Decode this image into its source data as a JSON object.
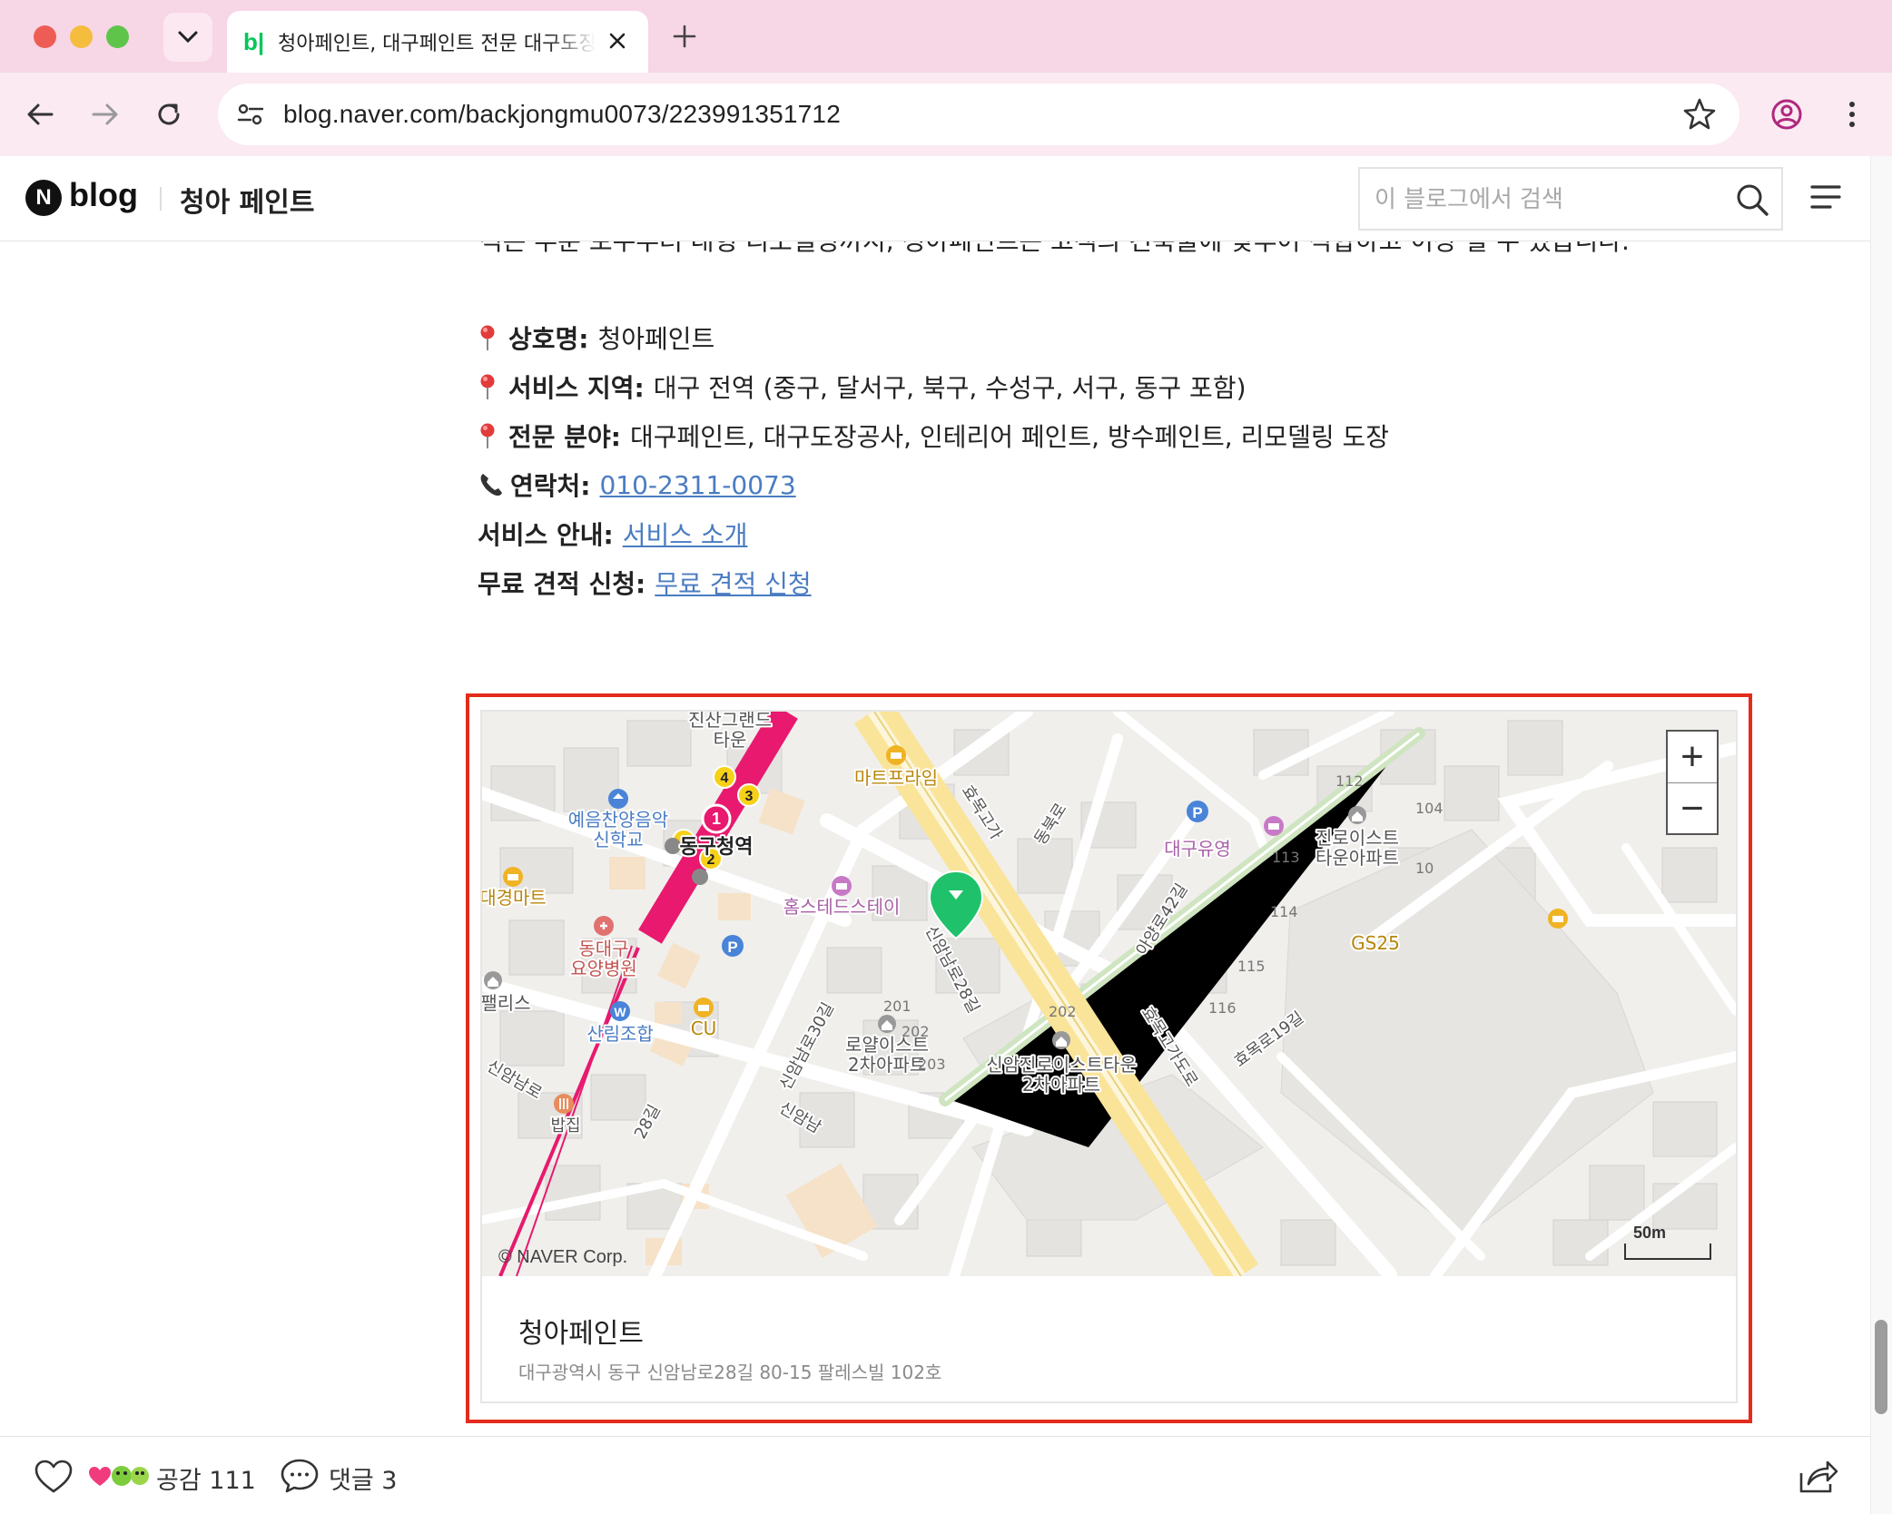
{
  "browser": {
    "tab_title": "청아페인트, 대구페인트 전문 대구도장공사",
    "tab_favicon": "b|",
    "url": "blog.naver.com/backjongmu0073/223991351712",
    "icons": [
      "chevron-down-icon",
      "close-icon",
      "plus-icon",
      "back-arrow-icon",
      "forward-arrow-icon",
      "reload-icon",
      "site-info-icon",
      "star-icon",
      "profile-icon",
      "kebab-menu-icon"
    ]
  },
  "header": {
    "logo_letter": "N",
    "logo_word": "blog",
    "blog_name": "청아 페인트",
    "search_placeholder": "이 블로그에서 검색"
  },
  "article": {
    "cut_line": "적은 부분 보수부터 대형 리모델링까지, 청아페인트는 고객의 건축물에 맞추어 적합하고 이상 할 수 있습니다.",
    "info": [
      {
        "icon": "pin-icon",
        "label": "상호명:",
        "value": "청아페인트"
      },
      {
        "icon": "pin-icon",
        "label": "서비스 지역:",
        "value": "대구 전역 (중구, 달서구, 북구, 수성구, 서구, 동구 포함)"
      },
      {
        "icon": "pin-icon",
        "label": "전문 분야:",
        "value": "대구페인트, 대구도장공사, 인테리어 페인트, 방수페인트, 리모델링 도장"
      },
      {
        "icon": "phone-icon",
        "label": "연락처:",
        "link": "010-2311-0073"
      },
      {
        "label": "서비스 안내:",
        "link": "서비스 소개"
      },
      {
        "label": "무료 견적 신청:",
        "link": "무료 견적 신청"
      }
    ]
  },
  "map": {
    "zoom_in": "+",
    "zoom_out": "−",
    "copyright": "© NAVER Corp.",
    "scale": "50m",
    "labels": {
      "jinsan": "진산그랜드",
      "jinsan2": "타운",
      "mart_prime": "마트프라임",
      "hyomok_high": "효목고가",
      "dongbuk": "동북로",
      "daegu_kinder": "대구유영",
      "jinro_east": "진로이스트",
      "jinro_east2": "타운아파트",
      "yeeum": "예음찬양음악",
      "yeeum2": "신학교",
      "station": "동구청역",
      "daegyeong": "대경마트",
      "homestead": "홈스테드스테이",
      "sinam28": "신암남로28길",
      "ayang42": "아양로42길",
      "gs25": "GS25",
      "hospital": "동대구",
      "hospital2": "요양병원",
      "palace": "팰리스",
      "sanrim": "산림조합",
      "cu": "CU",
      "royal_east": "로얄이스트",
      "royal_east2": "2차아파트",
      "sinam_jinro": "신암진로이스트타운",
      "sinam_jinro2": "2차아파트",
      "sinam30": "신암남로30길",
      "hyomok_road": "효목고가도로",
      "hyomok19": "효목로19길",
      "sinamnam": "신암남로",
      "n28": "28길",
      "sinamnam2": "신암남",
      "restaurant": "밥집",
      "exit1": "1",
      "exit2": "2",
      "exit3": "3",
      "exit4": "4",
      "b112": "112",
      "b113": "113",
      "b114": "114",
      "b115": "115",
      "b116": "116",
      "b201": "201",
      "b202": "202",
      "b202b": "202",
      "b203": "203",
      "b104": "104",
      "b10": "10"
    },
    "subway_color": "#e8196e",
    "road_yellow": "#f9e49a",
    "marker_color": "#1fc26b"
  },
  "place": {
    "name": "청아페인트",
    "address": "대구광역시 동구 신암남로28길 80-15 팔레스빌 102호"
  },
  "footer": {
    "like_text": "공감 111",
    "comment_text": "댓글 3"
  }
}
